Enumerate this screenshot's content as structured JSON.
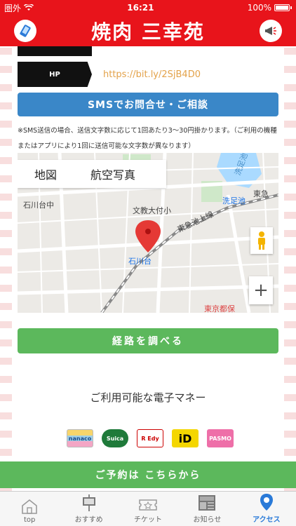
{
  "status_bar": {
    "carrier": "圏外",
    "time": "16:21",
    "battery": "100%"
  },
  "header": {
    "title": "焼肉 三幸苑"
  },
  "hp": {
    "tag": "HP",
    "link": "https://bit.ly/2SjB4D0"
  },
  "sms": {
    "button_label": "SMSでお問合せ・ご相談",
    "note": "※SMS送信の場合、送信文字数に応じて1回あたり3〜30円掛かります。（ご利用の機種またはアプリにより1回に送信可能な文字数が異なります）"
  },
  "map": {
    "tabs": [
      "地図",
      "航空写真"
    ],
    "labels": {
      "senzoku_pond": "洗足池",
      "senzokuike_station": "洗足池",
      "ishikawadai_chu": "石川台中",
      "bunkyo_otsuka": "文教大付小",
      "tokyu_ikegami": "東急池上線",
      "ishikawadai_station": "石川台",
      "tokyo_toritsu": "東京都保",
      "tokyu_short": "東急",
      "senzoku_temple": "洗足池"
    },
    "zoom_label": "+"
  },
  "route_button": "経路を調べる",
  "emoney": {
    "title": "ご利用可能な電子マネー",
    "cards": [
      "nanaco",
      "Suica",
      "R Edy",
      "iD",
      "PASMO"
    ]
  },
  "reserve_button": "ご予約は こちらから",
  "tabbar": {
    "items": [
      {
        "label": "top",
        "icon": "home-icon"
      },
      {
        "label": "おすすめ",
        "icon": "signboard-icon"
      },
      {
        "label": "チケット",
        "icon": "ticket-icon"
      },
      {
        "label": "お知らせ",
        "icon": "news-icon"
      },
      {
        "label": "アクセス",
        "icon": "location-pin-icon"
      }
    ]
  },
  "colors": {
    "brand_red": "#e8141b",
    "sms_blue": "#3a87c8",
    "action_green": "#5cb85c",
    "link_orange": "#e3a24a",
    "active_tab": "#2a7ad8"
  }
}
